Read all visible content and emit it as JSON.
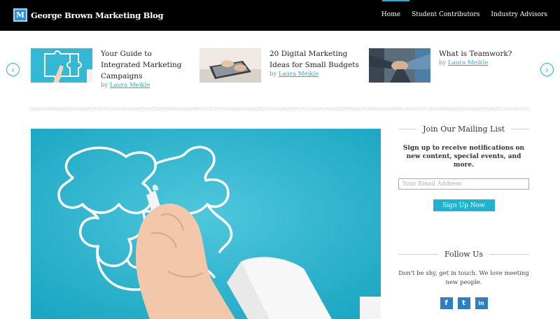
{
  "header": {
    "logo_letter": "M",
    "logo_text": "George Brown Marketing Blog",
    "nav": [
      "Home",
      "Student Contributors",
      "Industry Advisors"
    ]
  },
  "carousel": {
    "prev_icon": "chevron-left-icon",
    "next_icon": "chevron-right-icon",
    "items": [
      {
        "title": "Your Guide to Integrated Marketing Campaigns",
        "by": "by",
        "author": "Laura Meikle"
      },
      {
        "title": "20 Digital Marketing Ideas for Small Budgets",
        "by": "by",
        "author": "Laura Meikle"
      },
      {
        "title": "What is Teamwork?",
        "by": "by",
        "author": "Laura Meikle"
      }
    ]
  },
  "sidebar": {
    "mailing": {
      "heading": "Join Our Mailing List",
      "description": "Sign up to receive notifications on new content, special events, and more.",
      "email_placeholder": "Your Email Address",
      "button": "Sign Up Now"
    },
    "follow": {
      "heading": "Follow Us",
      "description": "Don't be shy, get in touch. We love meeting new people.",
      "social": [
        {
          "icon": "facebook-icon",
          "glyph": "f"
        },
        {
          "icon": "twitter-icon",
          "glyph": "t"
        },
        {
          "icon": "linkedin-icon",
          "glyph": "in"
        }
      ]
    }
  },
  "colors": {
    "accent": "#1fb3d1",
    "header_bg": "#000000",
    "hero_bg": "#2ab7cf"
  }
}
